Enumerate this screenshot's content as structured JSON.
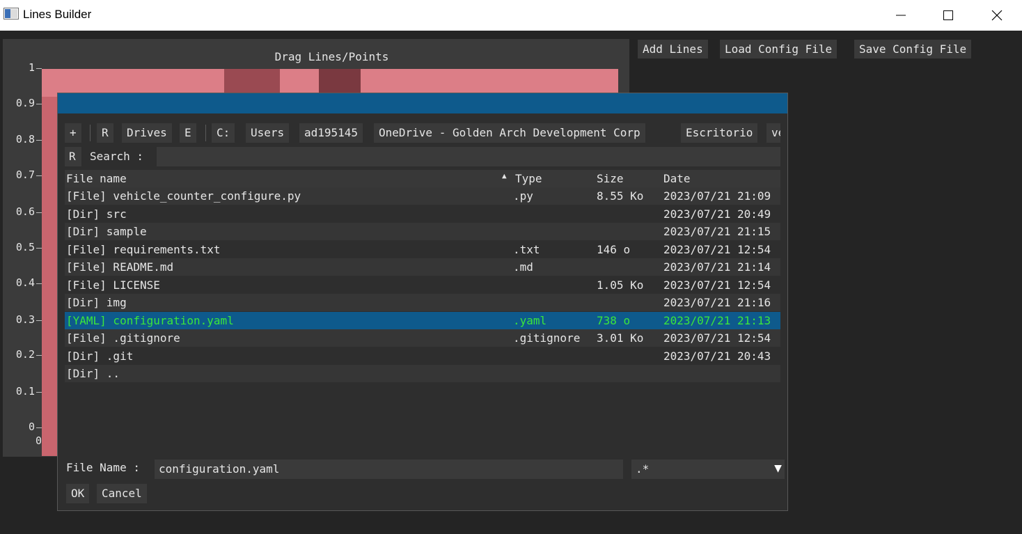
{
  "window": {
    "title": "Lines Builder"
  },
  "plot": {
    "title": "Drag Lines/Points",
    "y_ticks": [
      "1",
      "0.9",
      "0.8",
      "0.7",
      "0.6",
      "0.5",
      "0.4",
      "0.3",
      "0.2",
      "0.1",
      "0"
    ],
    "x_ticks": [
      "0"
    ]
  },
  "toolbar": {
    "add_lines": "Add Lines",
    "load_config": "Load Config File",
    "save_config": "Save Config File"
  },
  "dialog": {
    "path_buttons": [
      "+",
      "R",
      "Drives",
      "E",
      "C:",
      "Users",
      "ad195145",
      "OneDrive - Golden Arch Development Corp",
      "Escritorio",
      "ve"
    ],
    "search": {
      "refresh": "R",
      "label": "Search :",
      "value": ""
    },
    "columns": {
      "name": "File name",
      "type": "Type",
      "size": "Size",
      "date": "Date"
    },
    "sort_indicator": "▲",
    "rows": [
      {
        "name": "[File] vehicle_counter_configure.py",
        "type": ".py",
        "size": "8.55 Ko",
        "date": "2023/07/21 21:09"
      },
      {
        "name": "[Dir] src",
        "type": "",
        "size": "",
        "date": "2023/07/21 20:49"
      },
      {
        "name": "[Dir] sample",
        "type": "",
        "size": "",
        "date": "2023/07/21 21:15"
      },
      {
        "name": "[File] requirements.txt",
        "type": ".txt",
        "size": "146 o",
        "date": "2023/07/21 12:54"
      },
      {
        "name": "[File] README.md",
        "type": ".md",
        "size": "",
        "date": "2023/07/21 21:14"
      },
      {
        "name": "[File] LICENSE",
        "type": "",
        "size": "1.05 Ko",
        "date": "2023/07/21 12:54"
      },
      {
        "name": "[Dir] img",
        "type": "",
        "size": "",
        "date": "2023/07/21 21:16"
      },
      {
        "name": "[YAML] configuration.yaml",
        "type": ".yaml",
        "size": "738 o",
        "date": "2023/07/21 21:13",
        "selected": true
      },
      {
        "name": "[File] .gitignore",
        "type": ".gitignore",
        "size": "3.01 Ko",
        "date": "2023/07/21 12:54"
      },
      {
        "name": "[Dir] .git",
        "type": "",
        "size": "",
        "date": "2023/07/21 20:43"
      },
      {
        "name": "[Dir] ..",
        "type": "",
        "size": "",
        "date": ""
      }
    ],
    "file_name_label": "File Name :",
    "file_name_value": "configuration.yaml",
    "filter_value": ".*",
    "ok_label": "OK",
    "cancel_label": "Cancel"
  },
  "colors": {
    "dialog_title_bar": "#0e5a8c",
    "selected_row_bg": "#0e5a8c",
    "selected_row_text": "#3be63b",
    "plot_image_tint": "#c9656e"
  }
}
